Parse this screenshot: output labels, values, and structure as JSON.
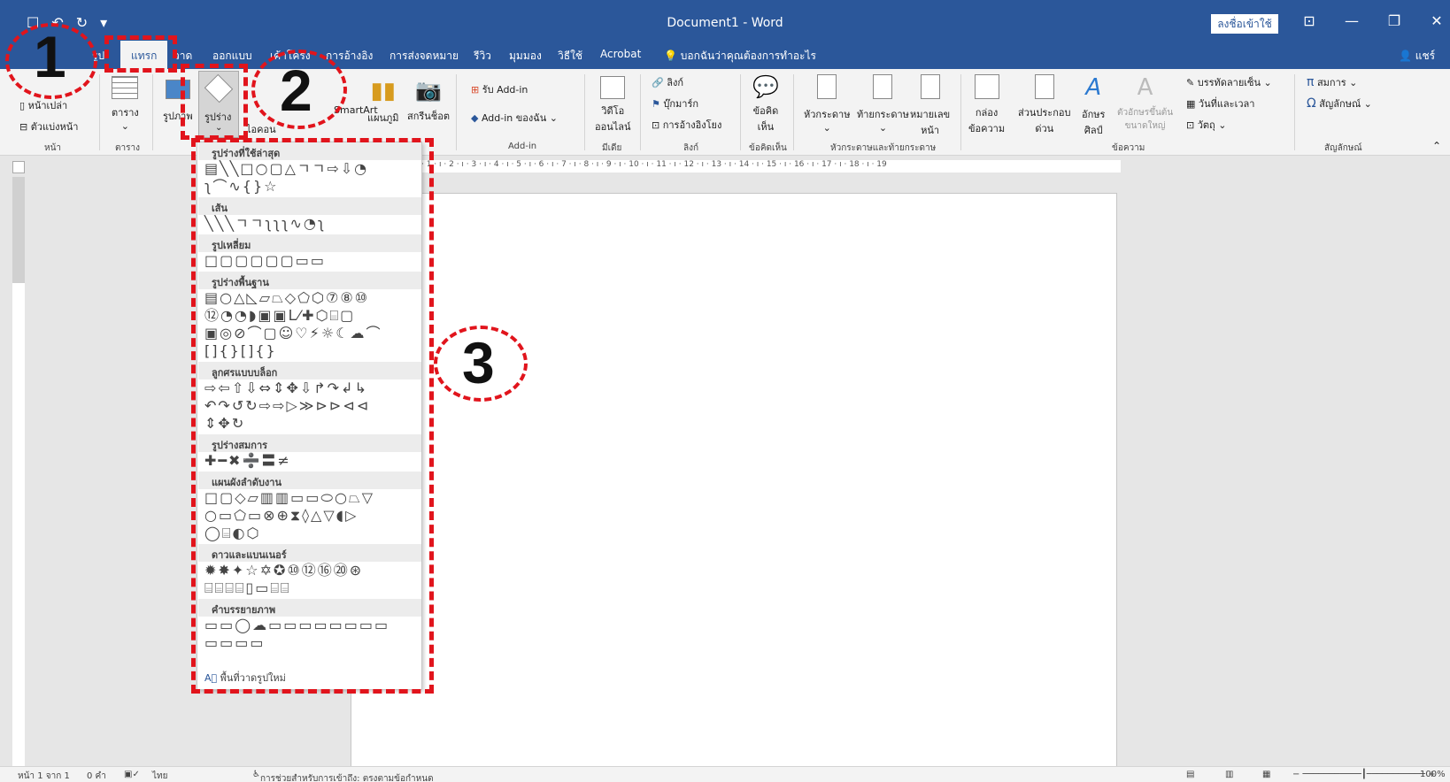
{
  "window": {
    "title": "Document1  -  Word",
    "signin_label": "ลงชื่อเข้าใช้",
    "quick_access": [
      "☐",
      "↶",
      "↻",
      "▾"
    ],
    "controls": [
      "⊡",
      "—",
      "❐",
      "✕"
    ]
  },
  "tabs": {
    "items": [
      "รูป",
      "แทรก",
      "วาด",
      "ออกแบบ",
      "เค้าโครง",
      "การอ้างอิง",
      "การส่งจดหมาย",
      "รีวิว",
      "มุมมอง",
      "วิธีใช้",
      "Acrobat"
    ],
    "active": "แทรก",
    "tell_me": "บอกฉันว่าคุณต้องการทำอะไร",
    "share": "แชร์"
  },
  "ribbon": {
    "pages": {
      "blank_page": "หน้าเปล่า",
      "page_break": "ตัวแบ่งหน้า",
      "group": "หน้า"
    },
    "tables": {
      "table": "ตาราง",
      "group": "ตาราง"
    },
    "illustrations": {
      "pictures": "รูปภาพ",
      "shapes": "รูปร่าง",
      "icons": "ไอคอน",
      "smartart": "SmartArt",
      "chart": "แผนภูมิ",
      "screenshot": "สกรีนช็อต"
    },
    "addins": {
      "get": "รับ Add-in",
      "my": "Add-in ของฉัน",
      "group": "Add-in"
    },
    "media": {
      "video": "วิดีโอ\nออนไลน์",
      "group": "มีเดีย"
    },
    "links": {
      "link": "ลิงก์",
      "bookmark": "บุ๊กมาร์ก",
      "cross_ref": "การอ้างอิงโยง",
      "group": "ลิงก์"
    },
    "comments": {
      "comment": "ข้อคิด\nเห็น",
      "group": "ข้อคิดเห็น"
    },
    "header_footer": {
      "header": "หัวกระดาษ",
      "footer": "ท้ายกระดาษ",
      "page_number": "หมายเลข\nหน้า",
      "group": "หัวกระดาษและท้ายกระดาษ"
    },
    "text": {
      "text_box": "กล่อง\nข้อความ",
      "quick_parts": "ส่วนประกอบ\nด่วน",
      "wordart": "อักษร\nศิลป์",
      "drop_cap": "ตัวอักษรขึ้นต้น\nขนาดใหญ่",
      "signature_line": "บรรทัดลายเซ็น",
      "date_time": "วันที่และเวลา",
      "object": "วัตถุ",
      "group": "ข้อความ"
    },
    "symbols": {
      "equation": "สมการ",
      "symbol": "สัญลักษณ์",
      "group": "สัญลักษณ์"
    }
  },
  "ruler": "· 1 · ı · 2 · ı · 3 · ı · 4 · ı · 5 · ı · 6 · ı · 7 · ı · 8 · ı · 9 · ı · 10 · ı · 11 · ı · 12 · ı · 13 · ı · 14 · ı · 15 · ı · 16 · ı · 17 · ı · 18 · ı · 19",
  "shapes_menu": {
    "recent": "รูปร่างที่ใช้ล่าสุด",
    "lines": "เส้น",
    "rectangles": "รูปเหลี่ยม",
    "basic": "รูปร่างพื้นฐาน",
    "block_arrows": "ลูกศรแบบบล็อก",
    "equation_shapes": "รูปร่างสมการ",
    "flowchart": "แผนผังลำดับงาน",
    "stars_banners": "ดาวและแบนเนอร์",
    "callouts": "คำบรรยายภาพ",
    "new_canvas": "พื้นที่วาดรูปใหม่",
    "rows": {
      "recent1": "▤╲╲□○▢△ㄱㄱ⇨⇩◔",
      "recent2": "ʅ⌒∿{}☆",
      "lines1": "╲╲╲ㄱㄱʅʅʅ∿◔ʅ",
      "rect1": "□▢▢▢▢▢▭▭",
      "basic1": "▤○△◺▱⏢◇⬠⬡⑦⑧⑩",
      "basic2": "⑫◔◔◗▣▣ᒪ⁄✚⬡⌸▢",
      "basic3": "▣◎⊘⌒▢☺♡⚡☼☾☁⌒",
      "basic4": "[]{}[]{}",
      "arrows1": "⇨⇦⇧⇩⇔⇕✥⇩↱↷↲↳",
      "arrows2": "↶↷↺↻⇨⇨▷≫⊳⊳⊲⊲",
      "arrows3": "⇕✥↻",
      "eq1": "✚━✖➗〓≠",
      "flow1": "□▢◇▱▥▥▭▭⬭○⏢▽",
      "flow2": "○▭⬠▭⊗⊕⧗◊△▽◖▷",
      "flow3": "◯⌸◐⬡",
      "stars1": "✹✸✦☆✡✪⑩⑫⑯⑳⊛",
      "stars2": "⌸⌸⌸⌸▯▭⌸⌸",
      "callouts1": "▭▭◯☁▭▭▭▭▭▭▭▭",
      "callouts2": "▭▭▭▭"
    }
  },
  "status": {
    "page": "หน้า 1 จาก 1",
    "words": "0 คำ",
    "lang": "ไทย",
    "accessibility": "การช่วยสำหรับการเข้าถึง: ตรงตามข้อกำหนด",
    "zoom": "100%"
  },
  "annotations": {
    "step1": "1",
    "step2": "2",
    "step3": "3"
  },
  "colors": {
    "title_bar": "#2b579a",
    "ribbon": "#f3f3f3",
    "annotation_red": "#e1141c"
  }
}
